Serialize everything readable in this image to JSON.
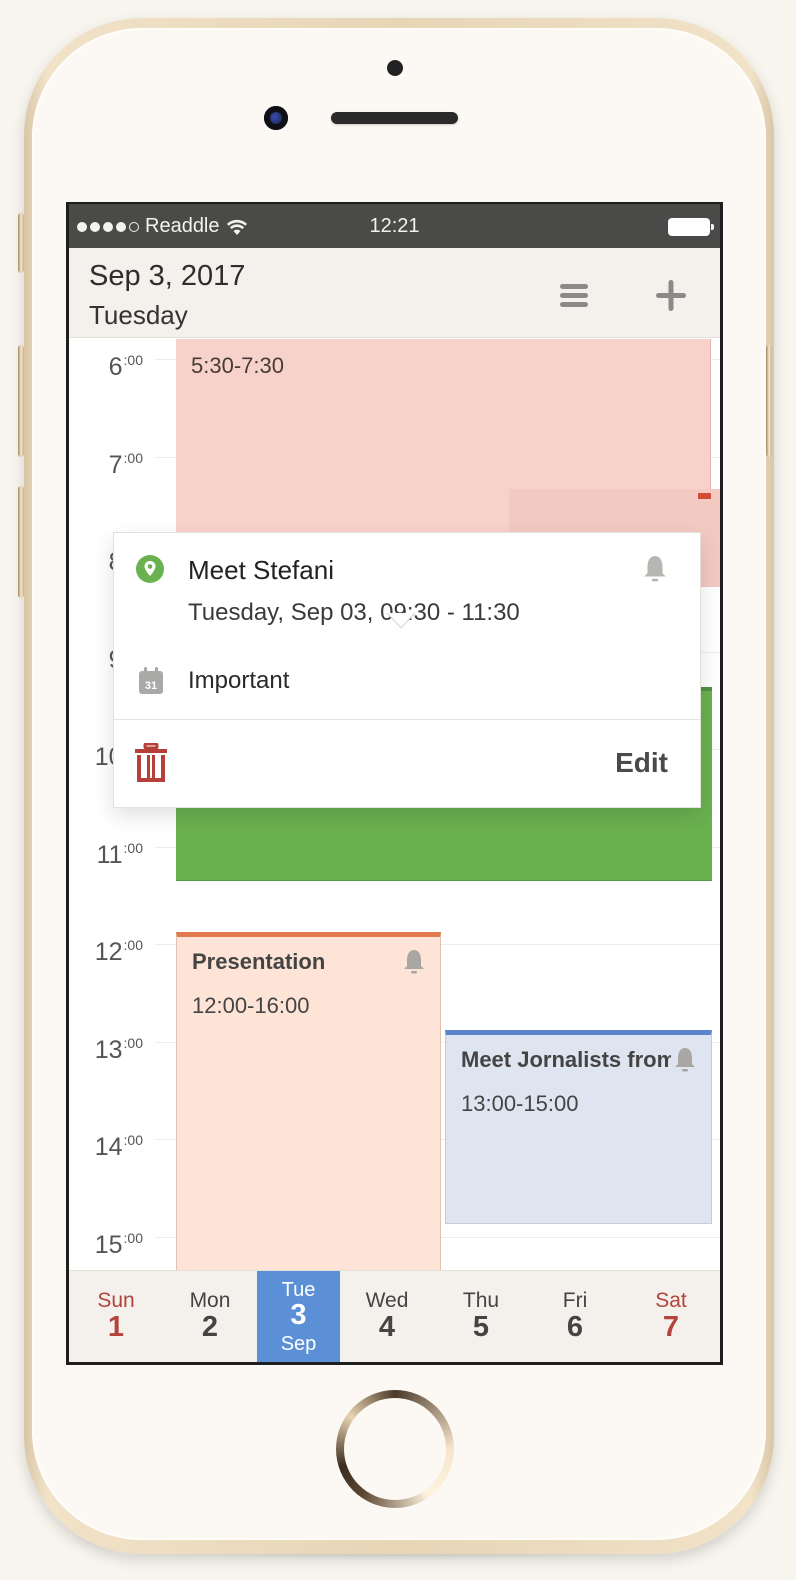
{
  "status_bar": {
    "carrier": "Readdle",
    "time": "12:21",
    "signal_bars_filled": 4,
    "signal_bars_total": 5
  },
  "header": {
    "date": "Sep 3, 2017",
    "weekday": "Tuesday",
    "menu_icon": "hamburger-menu-icon",
    "add_icon": "plus-icon"
  },
  "timeline": {
    "hours": [
      {
        "hour": "6",
        "minutes": ":00"
      },
      {
        "hour": "7",
        "minutes": ":00"
      },
      {
        "hour": "8",
        "minutes": ":00"
      },
      {
        "hour": "9",
        "minutes": ":00"
      },
      {
        "hour": "10",
        "minutes": ":00"
      },
      {
        "hour": "11",
        "minutes": ":00"
      },
      {
        "hour": "12",
        "minutes": ":00"
      },
      {
        "hour": "13",
        "minutes": ":00"
      },
      {
        "hour": "14",
        "minutes": ":00"
      },
      {
        "hour": "15",
        "minutes": ":00"
      }
    ],
    "events": [
      {
        "id": "early",
        "title": "",
        "time": "5:30-7:30",
        "color": "#f6d2ca",
        "has_alarm": false
      },
      {
        "id": "stefani",
        "title": "Meet Stefani",
        "time": "9:30-11:30",
        "color": "#6ab150",
        "has_alarm": true
      },
      {
        "id": "presentation",
        "title": "Presentation",
        "time": "12:00-16:00",
        "color": "#fde4d7",
        "accent": "#e27a4d",
        "has_alarm": true
      },
      {
        "id": "journalists",
        "title": "Meet Jornalists from",
        "time": "13:00-15:00",
        "color": "#dfe4f1",
        "accent": "#5b84cd",
        "has_alarm": true
      }
    ]
  },
  "popover": {
    "title": "Meet Stefani",
    "datetime": "Tuesday, Sep 03, 09:30 - 11:30",
    "calendar": "Important",
    "calendar_icon_day": "31",
    "edit_label": "Edit",
    "location_icon": "location-pin-icon",
    "delete_icon": "trash-icon",
    "pin_color": "#6ab150",
    "delete_color": "#b5403a"
  },
  "week_bar": {
    "days": [
      {
        "name": "Sun",
        "num": "1",
        "weekend": true
      },
      {
        "name": "Mon",
        "num": "2",
        "weekend": false
      },
      {
        "name": "Tue",
        "num": "3",
        "month": "Sep",
        "selected": true
      },
      {
        "name": "Wed",
        "num": "4",
        "weekend": false
      },
      {
        "name": "Thu",
        "num": "5",
        "weekend": false
      },
      {
        "name": "Fri",
        "num": "6",
        "weekend": false
      },
      {
        "name": "Sat",
        "num": "7",
        "weekend": true
      }
    ],
    "selected_color": "#5b8fd6"
  }
}
